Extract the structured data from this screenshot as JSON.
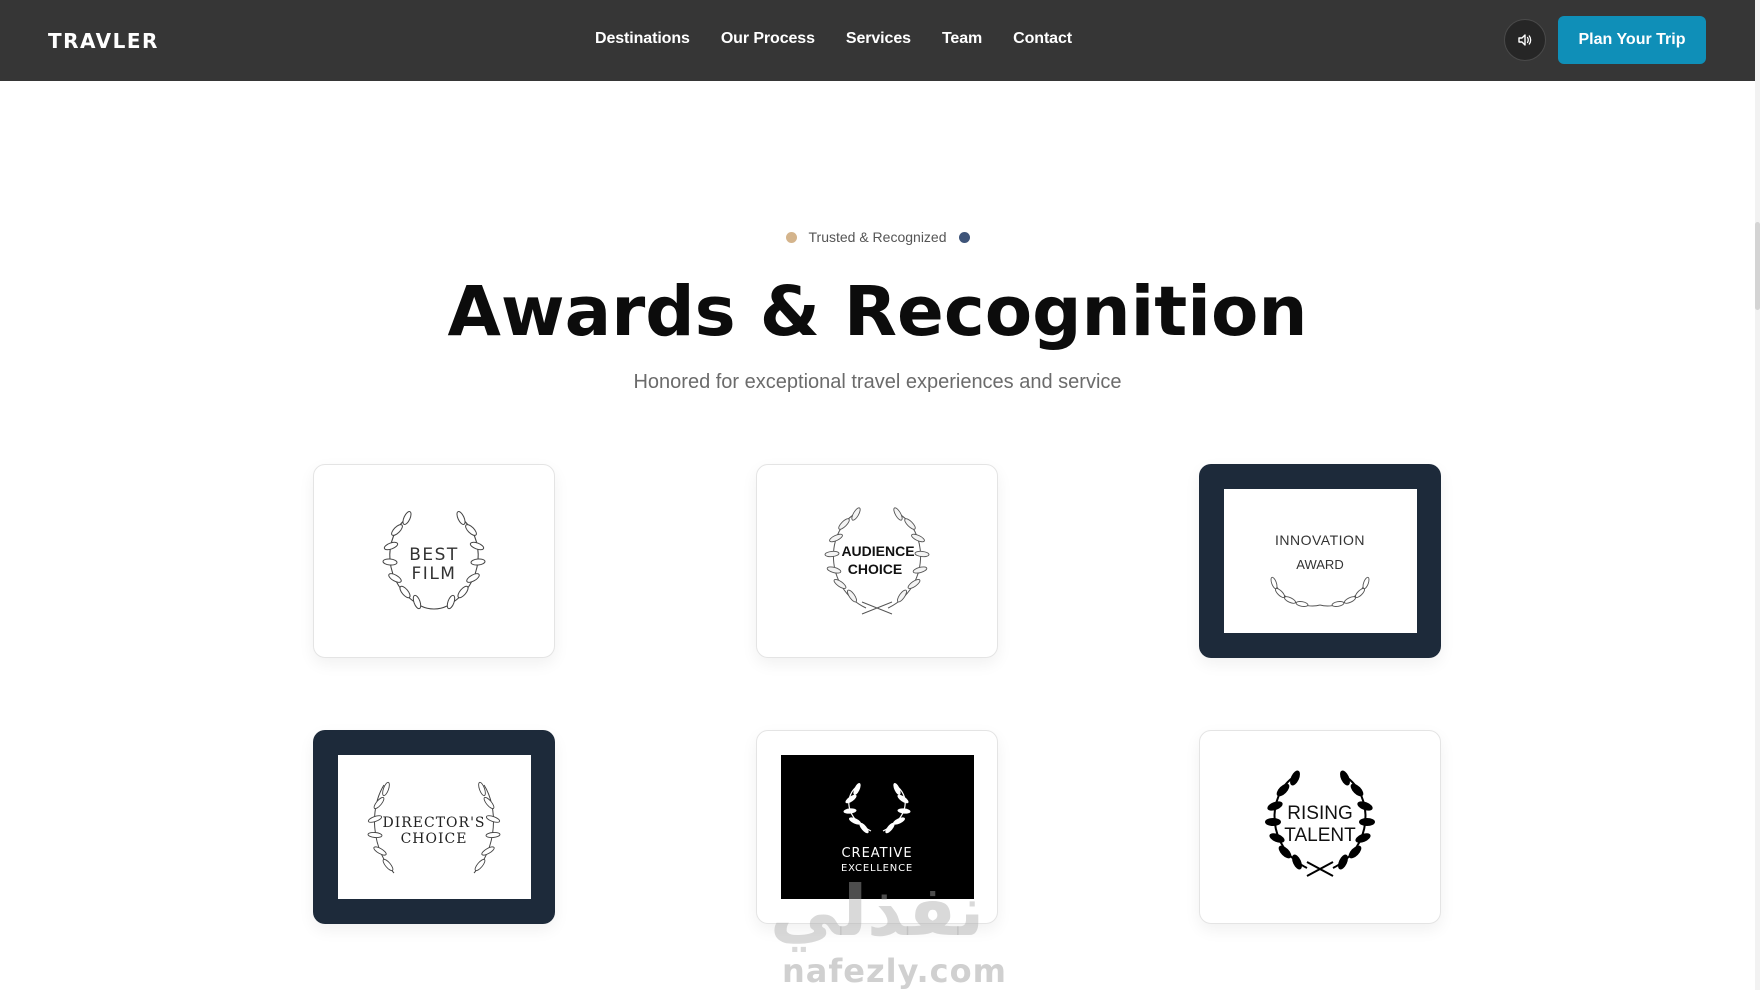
{
  "nav": {
    "brand": "TRAVLER",
    "links": [
      "Destinations",
      "Our Process",
      "Services",
      "Team",
      "Contact"
    ],
    "sound_icon": "speaker-icon",
    "cta_label": "Plan Your Trip",
    "cta_color": "#0f8fb8"
  },
  "section": {
    "eyebrow": "Trusted & Recognized",
    "eyebrow_dot_left_color": "#d4b48c",
    "eyebrow_dot_right_color": "#3e5479",
    "title": "Awards & Recognition",
    "subtitle": "Honored for exceptional travel experiences and service"
  },
  "awards": [
    {
      "line1": "BEST",
      "line2": "FILM",
      "style": "light"
    },
    {
      "line1": "AUDIENCE",
      "line2": "CHOICE",
      "style": "light"
    },
    {
      "line1": "INNOVATION",
      "line2": "AWARD",
      "style": "dark-framed"
    },
    {
      "line1": "DIRECTOR'S",
      "line2": "CHOICE",
      "style": "dark-framed"
    },
    {
      "line1": "CREATIVE",
      "line2": "EXCELLENCE",
      "style": "black-inner"
    },
    {
      "line1": "RISING",
      "line2": "TALENT",
      "style": "light-bold-laurel"
    }
  ],
  "watermark": {
    "arabic": "نفذلي",
    "latin": "nafezly.com"
  }
}
